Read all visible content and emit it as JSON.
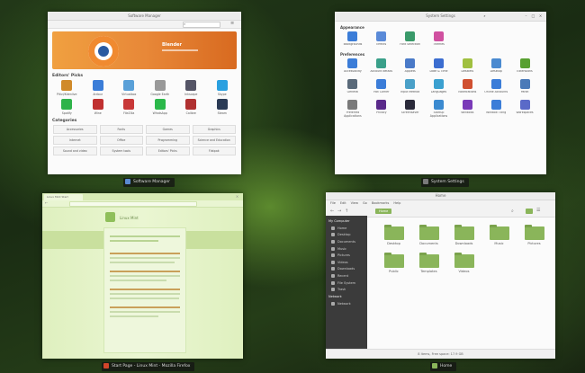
{
  "software_manager": {
    "title": "Software Manager",
    "caption": "Software Manager",
    "banner": {
      "app_name": "Blender"
    },
    "picks_heading": "Editors' Picks",
    "picks": [
      {
        "name": "Pitivi/Kdenlive",
        "color": "#d08a2a"
      },
      {
        "name": "Ardour",
        "color": "#3b7dd8"
      },
      {
        "name": "Virtualbox",
        "color": "#5aa0d8"
      },
      {
        "name": "Google Earth",
        "color": "#999999"
      },
      {
        "name": "Inkscape",
        "color": "#555566"
      },
      {
        "name": "Skype",
        "color": "#2aa0e0"
      },
      {
        "name": "Spotify",
        "color": "#2fb34a"
      },
      {
        "name": "Wine",
        "color": "#c03030"
      },
      {
        "name": "FileZilla",
        "color": "#c83838"
      },
      {
        "name": "WhatsApp",
        "color": "#2bb84a"
      },
      {
        "name": "Calibre",
        "color": "#b03030"
      },
      {
        "name": "Steam",
        "color": "#2a3a55"
      }
    ],
    "categories_heading": "Categories",
    "categories": [
      "Accessories",
      "Fonts",
      "Games",
      "Graphics",
      "Internet",
      "Office",
      "Programming",
      "Science and Education",
      "Sound and video",
      "System tools",
      "Editors' Picks",
      "Flatpak"
    ]
  },
  "system_settings": {
    "title": "System Settings",
    "caption": "System Settings",
    "sections": [
      {
        "name": "Appearance",
        "items": [
          {
            "name": "Backgrounds",
            "color": "#3b7dd8"
          },
          {
            "name": "Effects",
            "color": "#5a8ad8"
          },
          {
            "name": "Font Selection",
            "color": "#3a9a6a"
          },
          {
            "name": "Themes",
            "color": "#d050a0"
          }
        ]
      },
      {
        "name": "Preferences",
        "items": [
          {
            "name": "Accessibility",
            "color": "#3b7dd8"
          },
          {
            "name": "Account details",
            "color": "#3aa08a"
          },
          {
            "name": "Applets",
            "color": "#4a7ac8"
          },
          {
            "name": "Date & Time",
            "color": "#3b6dd0"
          },
          {
            "name": "Desklets",
            "color": "#a0c040"
          },
          {
            "name": "Desktop",
            "color": "#4a8ad0"
          },
          {
            "name": "Extensions",
            "color": "#58a030"
          },
          {
            "name": "General",
            "color": "#5a6a7a"
          },
          {
            "name": "Hot Corner",
            "color": "#3b7dd8"
          },
          {
            "name": "Input Method",
            "color": "#4aa0c8"
          },
          {
            "name": "Languages",
            "color": "#3ba0d0"
          },
          {
            "name": "Notifications",
            "color": "#d05030"
          },
          {
            "name": "Online Accounts",
            "color": "#3b7dd8"
          },
          {
            "name": "Panel",
            "color": "#4a7ab8"
          },
          {
            "name": "Preferred Applications",
            "color": "#7a7a7a"
          },
          {
            "name": "Privacy",
            "color": "#5a2a8a"
          },
          {
            "name": "Screensaver",
            "color": "#2a2a3a"
          },
          {
            "name": "Startup Applications",
            "color": "#3b8ad0"
          },
          {
            "name": "Windows",
            "color": "#7a3ab8"
          },
          {
            "name": "Window Tiling",
            "color": "#3b7dd8"
          },
          {
            "name": "Workspaces",
            "color": "#5a6ac8"
          }
        ]
      }
    ]
  },
  "browser": {
    "title": "Start Page - Linux Mint - Mozilla Firefox",
    "caption": "Start Page - Linux Mint - Mozilla Firefox",
    "tab_label": "Linux Mint Start",
    "site_title": "Linux Mint"
  },
  "files": {
    "title": "Home",
    "caption": "Home",
    "menu": [
      "File",
      "Edit",
      "View",
      "Go",
      "Bookmarks",
      "Help"
    ],
    "path": "Home",
    "sidebar_heading": "My Computer",
    "sidebar": [
      "Home",
      "Desktop",
      "Documents",
      "Music",
      "Pictures",
      "Videos",
      "Downloads",
      "Recent",
      "File System",
      "Trash"
    ],
    "devices_heading": "Network",
    "network_item": "Network",
    "folders": [
      "Desktop",
      "Documents",
      "Downloads",
      "Music",
      "Pictures",
      "Public",
      "Templates",
      "Videos"
    ],
    "status": "8 items, Free space: 17.9 GB"
  }
}
